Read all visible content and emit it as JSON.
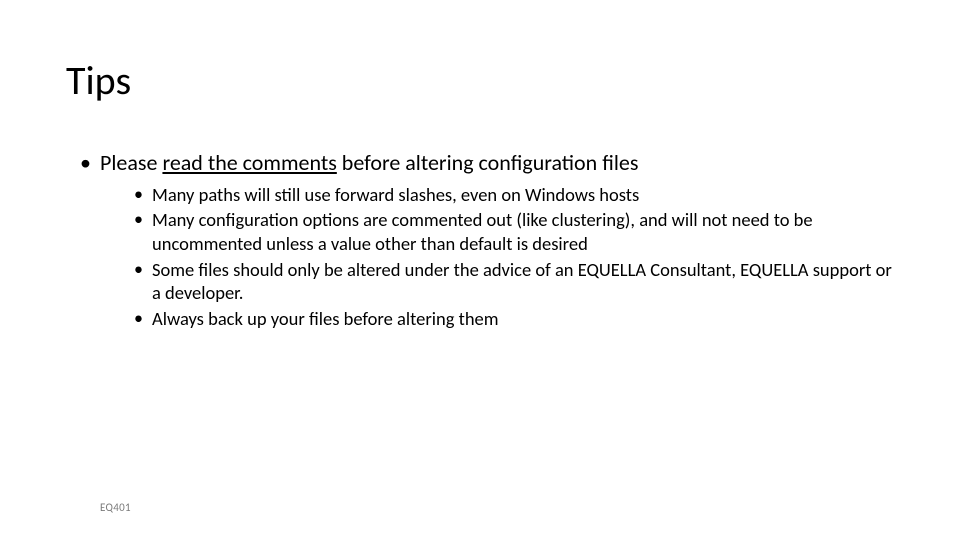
{
  "title": "Tips",
  "bullet1": {
    "prefix": "Please ",
    "underlined": "read the comments",
    "suffix": " before altering configuration files"
  },
  "sub": [
    "Many paths will still use forward slashes, even on Windows hosts",
    "Many configuration options are commented out (like clustering), and will not need to be uncommented unless a value other than default is desired",
    "Some files should only be altered under the advice of an EQUELLA Consultant, EQUELLA support or a developer.",
    "Always back up your files before altering them"
  ],
  "footer": "EQ401"
}
